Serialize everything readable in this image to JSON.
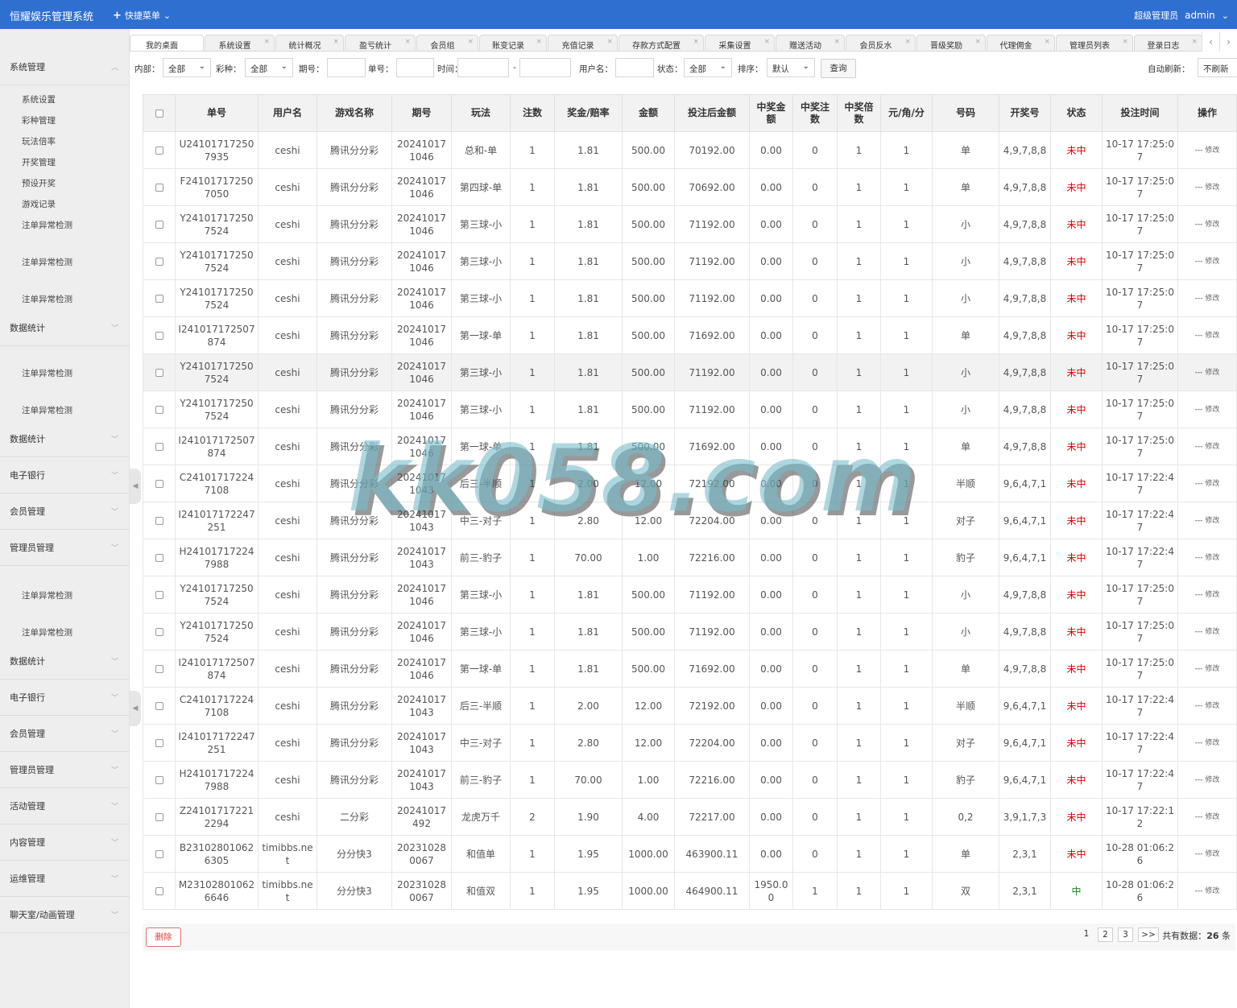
{
  "app": {
    "title": "恒耀娱乐管理系统",
    "quick_menu": "快捷菜单",
    "role": "超级管理员",
    "user": "admin"
  },
  "sidebar": {
    "sections": [
      {
        "label": "系统管理",
        "items": [
          "系统设置",
          "彩种管理",
          "玩法倍率",
          "开奖管理",
          "预设开奖",
          "游戏记录",
          "注单异常检测"
        ]
      },
      {
        "label": "",
        "items": [
          "注单异常检测",
          "注单异常检测"
        ]
      },
      {
        "label": "数据统计",
        "items": [
          "注单异常检测",
          "注单异常检测"
        ]
      },
      {
        "label": "数据统计"
      },
      {
        "label": "电子银行"
      },
      {
        "label": "会员管理"
      },
      {
        "label": "管理员管理",
        "items": [
          "注单异常检测",
          "注单异常检测"
        ]
      },
      {
        "label": "数据统计"
      },
      {
        "label": "电子银行"
      },
      {
        "label": "会员管理"
      },
      {
        "label": "管理员管理"
      },
      {
        "label": "活动管理"
      },
      {
        "label": "内容管理"
      },
      {
        "label": "运维管理"
      },
      {
        "label": "聊天室/动画管理"
      }
    ]
  },
  "tabs": [
    "我的桌面",
    "系统设置",
    "统计概况",
    "盈亏统计",
    "会员组",
    "账变记录",
    "充值记录",
    "存款方式配置",
    "采集设置",
    "赠送活动",
    "会员反水",
    "晋级奖励",
    "代理佣金",
    "管理员列表",
    "登录日志"
  ],
  "filters": {
    "inner_label": "内部：",
    "inner_value": "全部",
    "lottery_label": "彩种：",
    "lottery_value": "全部",
    "period_label": "期号：",
    "order_label": "单号：",
    "time_label": "时间：",
    "time_sep": "-",
    "username_label": "用户名：",
    "status_label": "状态：",
    "status_value": "全部",
    "sort_label": "排序：",
    "sort_value": "默认",
    "query_button": "查询",
    "refresh_label": "自动刷新：",
    "refresh_value": "不刷新"
  },
  "table": {
    "headers": [
      "单号",
      "用户名",
      "游戏名称",
      "期号",
      "玩法",
      "注数",
      "奖金/赔率",
      "金额",
      "投注后金额",
      "中奖金额",
      "中奖注数",
      "中奖倍数",
      "元/角/分",
      "号码",
      "开奖号",
      "状态",
      "投注时间",
      "操作"
    ],
    "action_dash": "---",
    "action_label": "修改",
    "rows": [
      [
        "U241017172507935",
        "ceshi",
        "腾讯分分彩",
        "202410171046",
        "总和-单",
        "1",
        "1.81",
        "500.00",
        "70192.00",
        "0.00",
        "0",
        "1",
        "1",
        "单",
        "4,9,7,8,8",
        "未中",
        "10-17 17:25:07"
      ],
      [
        "F241017172507050",
        "ceshi",
        "腾讯分分彩",
        "202410171046",
        "第四球-单",
        "1",
        "1.81",
        "500.00",
        "70692.00",
        "0.00",
        "0",
        "1",
        "1",
        "单",
        "4,9,7,8,8",
        "未中",
        "10-17 17:25:07"
      ],
      [
        "Y241017172507524",
        "ceshi",
        "腾讯分分彩",
        "202410171046",
        "第三球-小",
        "1",
        "1.81",
        "500.00",
        "71192.00",
        "0.00",
        "0",
        "1",
        "1",
        "小",
        "4,9,7,8,8",
        "未中",
        "10-17 17:25:07"
      ],
      [
        "Y241017172507524",
        "ceshi",
        "腾讯分分彩",
        "202410171046",
        "第三球-小",
        "1",
        "1.81",
        "500.00",
        "71192.00",
        "0.00",
        "0",
        "1",
        "1",
        "小",
        "4,9,7,8,8",
        "未中",
        "10-17 17:25:07"
      ],
      [
        "Y241017172507524",
        "ceshi",
        "腾讯分分彩",
        "202410171046",
        "第三球-小",
        "1",
        "1.81",
        "500.00",
        "71192.00",
        "0.00",
        "0",
        "1",
        "1",
        "小",
        "4,9,7,8,8",
        "未中",
        "10-17 17:25:07"
      ],
      [
        "I241017172507874",
        "ceshi",
        "腾讯分分彩",
        "202410171046",
        "第一球-单",
        "1",
        "1.81",
        "500.00",
        "71692.00",
        "0.00",
        "0",
        "1",
        "1",
        "单",
        "4,9,7,8,8",
        "未中",
        "10-17 17:25:07"
      ],
      [
        "Y241017172507524",
        "ceshi",
        "腾讯分分彩",
        "202410171046",
        "第三球-小",
        "1",
        "1.81",
        "500.00",
        "71192.00",
        "0.00",
        "0",
        "1",
        "1",
        "小",
        "4,9,7,8,8",
        "未中",
        "10-17 17:25:07"
      ],
      [
        "Y241017172507524",
        "ceshi",
        "腾讯分分彩",
        "202410171046",
        "第三球-小",
        "1",
        "1.81",
        "500.00",
        "71192.00",
        "0.00",
        "0",
        "1",
        "1",
        "小",
        "4,9,7,8,8",
        "未中",
        "10-17 17:25:07"
      ],
      [
        "I241017172507874",
        "ceshi",
        "腾讯分分彩",
        "202410171046",
        "第一球-单",
        "1",
        "1.81",
        "500.00",
        "71692.00",
        "0.00",
        "0",
        "1",
        "1",
        "单",
        "4,9,7,8,8",
        "未中",
        "10-17 17:25:07"
      ],
      [
        "C241017172247108",
        "ceshi",
        "腾讯分分彩",
        "202410171043",
        "后三-半顺",
        "1",
        "2.00",
        "12.00",
        "72192.00",
        "0.00",
        "0",
        "1",
        "1",
        "半顺",
        "9,6,4,7,1",
        "未中",
        "10-17 17:22:47"
      ],
      [
        "I241017172247251",
        "ceshi",
        "腾讯分分彩",
        "202410171043",
        "中三-对子",
        "1",
        "2.80",
        "12.00",
        "72204.00",
        "0.00",
        "0",
        "1",
        "1",
        "对子",
        "9,6,4,7,1",
        "未中",
        "10-17 17:22:47"
      ],
      [
        "H241017172247988",
        "ceshi",
        "腾讯分分彩",
        "202410171043",
        "前三-豹子",
        "1",
        "70.00",
        "1.00",
        "72216.00",
        "0.00",
        "0",
        "1",
        "1",
        "豹子",
        "9,6,4,7,1",
        "未中",
        "10-17 17:22:47"
      ],
      [
        "Y241017172507524",
        "ceshi",
        "腾讯分分彩",
        "202410171046",
        "第三球-小",
        "1",
        "1.81",
        "500.00",
        "71192.00",
        "0.00",
        "0",
        "1",
        "1",
        "小",
        "4,9,7,8,8",
        "未中",
        "10-17 17:25:07"
      ],
      [
        "Y241017172507524",
        "ceshi",
        "腾讯分分彩",
        "202410171046",
        "第三球-小",
        "1",
        "1.81",
        "500.00",
        "71192.00",
        "0.00",
        "0",
        "1",
        "1",
        "小",
        "4,9,7,8,8",
        "未中",
        "10-17 17:25:07"
      ],
      [
        "I241017172507874",
        "ceshi",
        "腾讯分分彩",
        "202410171046",
        "第一球-单",
        "1",
        "1.81",
        "500.00",
        "71692.00",
        "0.00",
        "0",
        "1",
        "1",
        "单",
        "4,9,7,8,8",
        "未中",
        "10-17 17:25:07"
      ],
      [
        "C241017172247108",
        "ceshi",
        "腾讯分分彩",
        "202410171043",
        "后三-半顺",
        "1",
        "2.00",
        "12.00",
        "72192.00",
        "0.00",
        "0",
        "1",
        "1",
        "半顺",
        "9,6,4,7,1",
        "未中",
        "10-17 17:22:47"
      ],
      [
        "I241017172247251",
        "ceshi",
        "腾讯分分彩",
        "202410171043",
        "中三-对子",
        "1",
        "2.80",
        "12.00",
        "72204.00",
        "0.00",
        "0",
        "1",
        "1",
        "对子",
        "9,6,4,7,1",
        "未中",
        "10-17 17:22:47"
      ],
      [
        "H241017172247988",
        "ceshi",
        "腾讯分分彩",
        "202410171043",
        "前三-豹子",
        "1",
        "70.00",
        "1.00",
        "72216.00",
        "0.00",
        "0",
        "1",
        "1",
        "豹子",
        "9,6,4,7,1",
        "未中",
        "10-17 17:22:47"
      ],
      [
        "Z241017172212294",
        "ceshi",
        "二分彩",
        "20241017492",
        "龙虎万千",
        "2",
        "1.90",
        "4.00",
        "72217.00",
        "0.00",
        "0",
        "1",
        "1",
        "0,2",
        "3,9,1,7,3",
        "未中",
        "10-17 17:22:12"
      ],
      [
        "B231028010626305",
        "timibbs.net",
        "分分快3",
        "202310280067",
        "和值单",
        "1",
        "1.95",
        "1000.00",
        "463900.11",
        "0.00",
        "0",
        "1",
        "1",
        "单",
        "2,3,1",
        "未中",
        "10-28 01:06:26"
      ],
      [
        "M231028010626646",
        "timibbs.net",
        "分分快3",
        "202310280067",
        "和值双",
        "1",
        "1.95",
        "1000.00",
        "464900.11",
        "1950.00",
        "1",
        "1",
        "1",
        "双",
        "2,3,1",
        "中",
        "10-28 01:06:26"
      ]
    ]
  },
  "footer": {
    "delete_button": "删除",
    "pages": [
      "1",
      "2",
      "3"
    ],
    "next": ">>",
    "total_prefix": "共有数据：",
    "total_count": "26",
    "total_suffix": " 条"
  },
  "watermark": "kk058.com",
  "colors": {
    "topbar": "#2f6fd0",
    "miss": "#e00000",
    "win": "#1a8a1a"
  }
}
